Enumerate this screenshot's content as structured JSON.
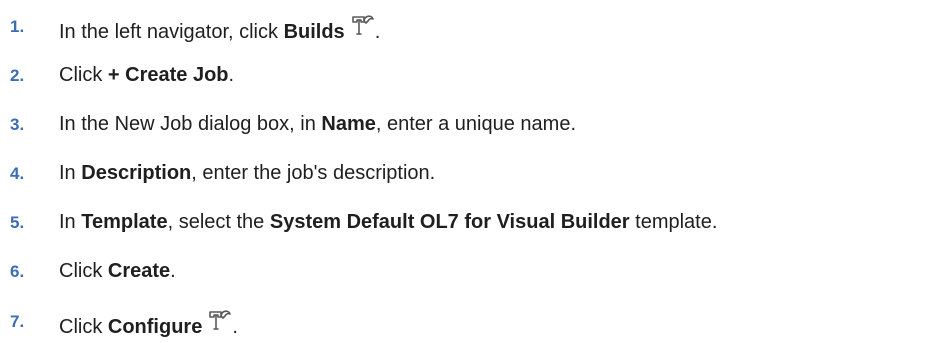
{
  "steps": [
    {
      "number": "1.",
      "pre": "In the left navigator, click ",
      "bold": "Builds",
      "icon": "hammer-icon",
      "post": "."
    },
    {
      "number": "2.",
      "pre": "Click ",
      "bold": "+ Create Job",
      "post": "."
    },
    {
      "number": "3.",
      "pre": "In the New Job dialog box, in ",
      "bold": "Name",
      "post": ", enter a unique name."
    },
    {
      "number": "4.",
      "pre": "In ",
      "bold": "Description",
      "post": ", enter the job's description."
    },
    {
      "number": "5.",
      "pre": "In ",
      "bold": "Template",
      "mid": ", select the ",
      "bold2": "System Default OL7 for Visual Builder",
      "post": " template."
    },
    {
      "number": "6.",
      "pre": "Click ",
      "bold": "Create",
      "post": "."
    },
    {
      "number": "7.",
      "pre": "Click ",
      "bold": "Configure",
      "icon": "hammer-icon",
      "post": "."
    }
  ],
  "colors": {
    "step_number": "#3c6eb4",
    "text": "#1f1f1f",
    "icon": "#5a5a5a"
  }
}
